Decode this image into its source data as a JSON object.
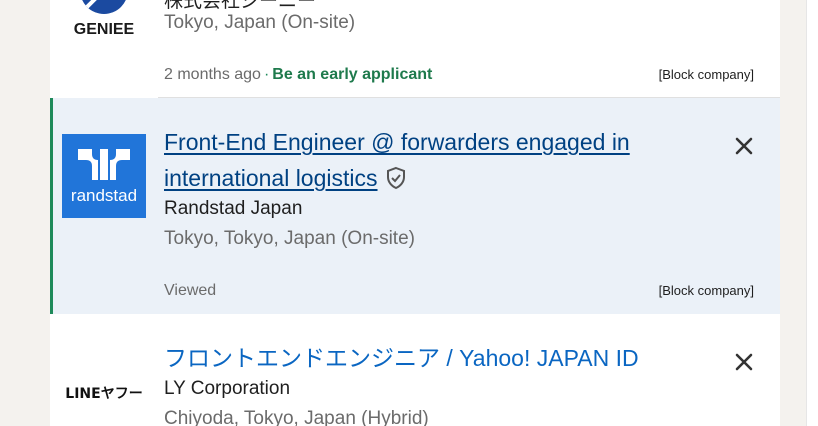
{
  "jobs": [
    {
      "logo_text": "GENIEE",
      "company": "株式会社ジーニー",
      "location": "Tokyo, Japan (On-site)",
      "posted": "2 months ago",
      "early": "Be an early applicant",
      "block": "[Block company]"
    },
    {
      "logo_text": "randstad",
      "title_line1": "Front-End Engineer @ forwarders engaged in",
      "title_line2": "international logistics",
      "company": "Randstad Japan",
      "location": "Tokyo, Tokyo, Japan (On-site)",
      "status": "Viewed",
      "block": "[Block company]"
    },
    {
      "logo_text": "LINEヤフー",
      "title": "フロントエンドエンジニア / Yahoo! JAPAN ID",
      "company": "LY Corporation",
      "location": "Chiyoda, Tokyo, Japan (Hybrid)"
    }
  ],
  "colors": {
    "link": "#0a66c2",
    "selected_bg": "#ebf1f8",
    "accent": "#1e8a5a",
    "randstad_blue": "#2175d9"
  },
  "icons": [
    "geniee-logo-icon",
    "randstad-logo-icon",
    "verified-shield-icon",
    "close-icon",
    "line-yahoo-logo-icon"
  ]
}
